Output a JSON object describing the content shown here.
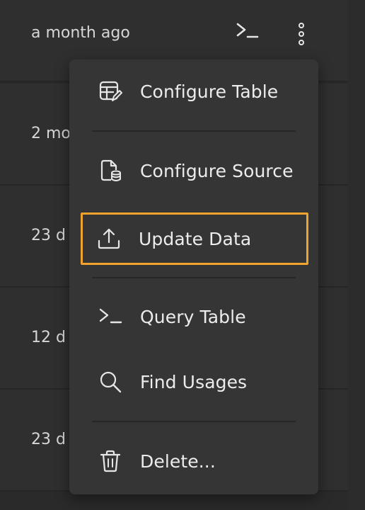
{
  "rows": [
    {
      "time": "a month ago"
    },
    {
      "time": "2 mo"
    },
    {
      "time": "23 d"
    },
    {
      "time": "12 d"
    },
    {
      "time": "23 d"
    }
  ],
  "toolbar": {
    "query_icon": "terminal-icon",
    "more_icon": "more-vertical-icon"
  },
  "menu": {
    "items": [
      {
        "label": "Configure Table",
        "icon": "table-edit-icon"
      },
      {
        "label": "Configure Source",
        "icon": "source-database-icon"
      },
      {
        "label": "Update Data",
        "icon": "upload-icon",
        "highlighted": true
      },
      {
        "label": "Query Table",
        "icon": "terminal-icon"
      },
      {
        "label": "Find Usages",
        "icon": "search-icon"
      },
      {
        "label": "Delete...",
        "icon": "trash-icon"
      }
    ]
  },
  "colors": {
    "background": "#2a2a2a",
    "menu_background": "#353535",
    "highlight": "#f0a22e",
    "text": "#ececec"
  }
}
